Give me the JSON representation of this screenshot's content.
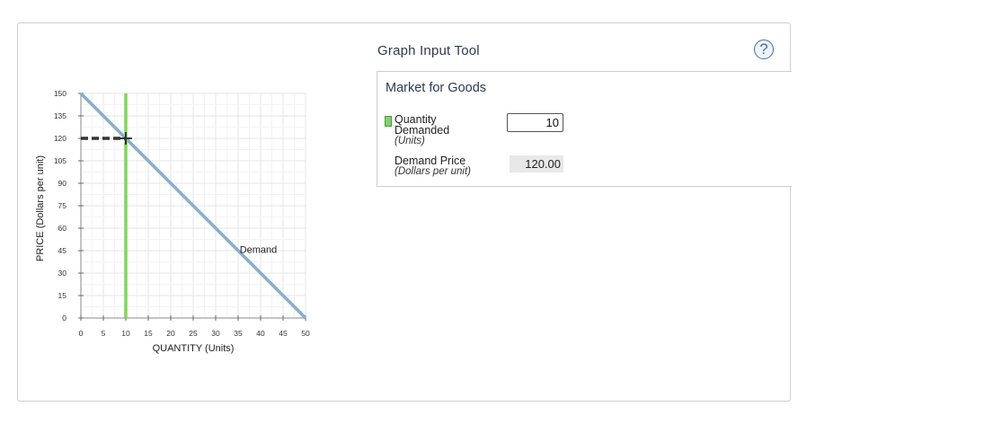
{
  "tool": {
    "title": "Graph Input Tool",
    "help_label": "?"
  },
  "market": {
    "title": "Market for Goods",
    "quantity_label_line1": "Quantity",
    "quantity_label_line2": "Demanded",
    "quantity_units": "(Units)",
    "quantity_value": "10",
    "price_label": "Demand Price",
    "price_units": "(Dollars per unit)",
    "price_value": "120.00"
  },
  "colors": {
    "demand": "#86aece",
    "quantity_line": "#7ed957",
    "dashed": "#333333"
  },
  "chart_data": {
    "type": "line",
    "xlabel": "QUANTITY (Units)",
    "ylabel": "PRICE (Dollars per unit)",
    "xlim": [
      0,
      50
    ],
    "ylim": [
      0,
      150
    ],
    "x_ticks": [
      0,
      5,
      10,
      15,
      20,
      25,
      30,
      35,
      40,
      45,
      50
    ],
    "y_ticks": [
      0,
      15,
      30,
      45,
      60,
      75,
      90,
      105,
      120,
      135,
      150
    ],
    "grid": true,
    "series": [
      {
        "name": "Demand",
        "x": [
          0,
          50
        ],
        "y": [
          150,
          0
        ]
      }
    ],
    "selected_quantity": 10,
    "selected_price": 120
  }
}
